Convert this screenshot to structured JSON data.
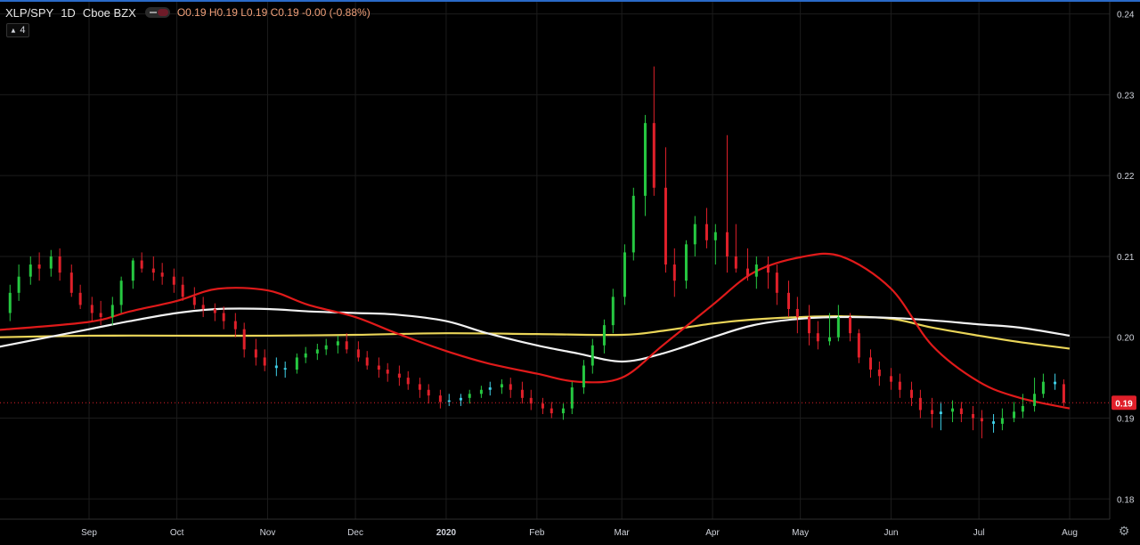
{
  "legend": {
    "symbol": "XLP/SPY",
    "timeframe": "1D",
    "exchange": "Cboe BZX",
    "open_label": "O",
    "open": "0.19",
    "high_label": "H",
    "high": "0.19",
    "low_label": "L",
    "low": "0.19",
    "close_label": "C",
    "close": "0.19",
    "change": "-0.00 (-0.88%)",
    "indicator_count": "4"
  },
  "icons": {
    "toggle": "visibility-toggle-icon",
    "collapse": "chevron-up-icon",
    "settings": "gear-icon"
  },
  "colors": {
    "background": "#000000",
    "grid": "#1c1c1c",
    "up_candle": "#26c841",
    "down_candle": "#e0202a",
    "doji_candle": "#3fd0e8",
    "ma_red": "#e01a1a",
    "ma_white": "#f2f2f2",
    "ma_yellow": "#ead558",
    "axis_text": "#d1d4dc",
    "price_badge": "#e0202a",
    "accent": "#2a6ac8"
  },
  "chart_data": {
    "type": "candlestick",
    "title": "XLP/SPY",
    "ylim": [
      0.1775,
      0.2415
    ],
    "y_ticks": [
      "0.24",
      "0.23",
      "0.22",
      "0.21",
      "0.20",
      "0.19",
      "0.18"
    ],
    "y_tick_values": [
      0.24,
      0.23,
      0.22,
      0.21,
      0.2,
      0.19,
      0.18
    ],
    "x_ticks": [
      "Sep",
      "Oct",
      "Nov",
      "Dec",
      "2020",
      "Feb",
      "Mar",
      "Apr",
      "May",
      "Jun",
      "Jul",
      "Aug"
    ],
    "x_tick_dates": [
      "2019-09-01",
      "2019-10-01",
      "2019-11-01",
      "2019-12-01",
      "2020-01-01",
      "2020-02-01",
      "2020-03-01",
      "2020-04-01",
      "2020-05-01",
      "2020-06-01",
      "2020-07-01",
      "2020-08-01"
    ],
    "last_price": "0.19",
    "last_price_value": 0.1919,
    "series": [
      {
        "name": "Close",
        "dates": [
          "2019-08-01",
          "2019-08-05",
          "2019-08-08",
          "2019-08-12",
          "2019-08-15",
          "2019-08-19",
          "2019-08-22",
          "2019-08-26",
          "2019-08-29",
          "2019-09-02",
          "2019-09-05",
          "2019-09-09",
          "2019-09-12",
          "2019-09-16",
          "2019-09-19",
          "2019-09-23",
          "2019-09-26",
          "2019-09-30",
          "2019-10-03",
          "2019-10-07",
          "2019-10-10",
          "2019-10-14",
          "2019-10-17",
          "2019-10-21",
          "2019-10-24",
          "2019-10-28",
          "2019-10-31",
          "2019-11-04",
          "2019-11-07",
          "2019-11-11",
          "2019-11-14",
          "2019-11-18",
          "2019-11-21",
          "2019-11-25",
          "2019-11-28",
          "2019-12-02",
          "2019-12-05",
          "2019-12-09",
          "2019-12-12",
          "2019-12-16",
          "2019-12-19",
          "2019-12-23",
          "2019-12-26",
          "2019-12-30",
          "2020-01-02",
          "2020-01-06",
          "2020-01-09",
          "2020-01-13",
          "2020-01-16",
          "2020-01-20",
          "2020-01-23",
          "2020-01-27",
          "2020-01-30",
          "2020-02-03",
          "2020-02-06",
          "2020-02-10",
          "2020-02-13",
          "2020-02-17",
          "2020-02-20",
          "2020-02-24",
          "2020-02-27",
          "2020-03-02",
          "2020-03-05",
          "2020-03-09",
          "2020-03-12",
          "2020-03-16",
          "2020-03-19",
          "2020-03-23",
          "2020-03-26",
          "2020-03-30",
          "2020-04-02",
          "2020-04-06",
          "2020-04-09",
          "2020-04-13",
          "2020-04-16",
          "2020-04-20",
          "2020-04-23",
          "2020-04-27",
          "2020-04-30",
          "2020-05-04",
          "2020-05-07",
          "2020-05-11",
          "2020-05-14",
          "2020-05-18",
          "2020-05-21",
          "2020-05-25",
          "2020-05-28",
          "2020-06-01",
          "2020-06-04",
          "2020-06-08",
          "2020-06-11",
          "2020-06-15",
          "2020-06-18",
          "2020-06-22",
          "2020-06-25",
          "2020-06-29",
          "2020-07-02",
          "2020-07-06",
          "2020-07-09",
          "2020-07-13",
          "2020-07-16",
          "2020-07-20",
          "2020-07-23",
          "2020-07-27",
          "2020-07-30"
        ],
        "open": [
          0.2022,
          0.203,
          0.2055,
          0.2075,
          0.209,
          0.2085,
          0.21,
          0.208,
          0.2055,
          0.204,
          0.203,
          0.2025,
          0.204,
          0.207,
          0.2095,
          0.2085,
          0.208,
          0.2075,
          0.2065,
          0.205,
          0.204,
          0.2035,
          0.203,
          0.202,
          0.201,
          0.1985,
          0.1975,
          0.1965,
          0.1962,
          0.196,
          0.1975,
          0.198,
          0.1985,
          0.199,
          0.1995,
          0.1985,
          0.1975,
          0.1965,
          0.196,
          0.1955,
          0.195,
          0.1942,
          0.1935,
          0.1928,
          0.192,
          0.1922,
          0.1925,
          0.193,
          0.1935,
          0.1938,
          0.1942,
          0.1935,
          0.1925,
          0.1918,
          0.1912,
          0.1906,
          0.1912,
          0.1938,
          0.1965,
          0.199,
          0.2015,
          0.205,
          0.2105,
          0.2175,
          0.2265,
          0.2185,
          0.209,
          0.207,
          0.2115,
          0.214,
          0.212,
          0.213,
          0.21,
          0.2085,
          0.2075,
          0.209,
          0.208,
          0.2055,
          0.2035,
          0.2025,
          0.2005,
          0.1995,
          0.2,
          0.2025,
          0.2005,
          0.1975,
          0.196,
          0.1952,
          0.1945,
          0.1935,
          0.1925,
          0.191,
          0.1905,
          0.1908,
          0.1912,
          0.1905,
          0.19,
          0.1896,
          0.1893,
          0.19,
          0.1908,
          0.1915,
          0.193,
          0.1945,
          0.1942
        ],
        "high": [
          0.2045,
          0.2065,
          0.209,
          0.21,
          0.2105,
          0.2108,
          0.211,
          0.209,
          0.2065,
          0.205,
          0.2045,
          0.205,
          0.2075,
          0.2098,
          0.2105,
          0.21,
          0.2092,
          0.2085,
          0.2075,
          0.2062,
          0.205,
          0.2042,
          0.2038,
          0.203,
          0.2018,
          0.1998,
          0.1985,
          0.1975,
          0.197,
          0.198,
          0.1988,
          0.1992,
          0.1998,
          0.2002,
          0.2005,
          0.1995,
          0.1983,
          0.1975,
          0.1968,
          0.1965,
          0.1958,
          0.195,
          0.1942,
          0.1935,
          0.193,
          0.193,
          0.1935,
          0.194,
          0.1945,
          0.1948,
          0.195,
          0.1945,
          0.1935,
          0.1925,
          0.192,
          0.1918,
          0.1945,
          0.1972,
          0.1998,
          0.2022,
          0.206,
          0.2115,
          0.2185,
          0.2275,
          0.2335,
          0.2235,
          0.211,
          0.212,
          0.215,
          0.216,
          0.214,
          0.225,
          0.214,
          0.211,
          0.21,
          0.21,
          0.209,
          0.207,
          0.205,
          0.204,
          0.202,
          0.203,
          0.204,
          0.203,
          0.201,
          0.1985,
          0.197,
          0.1962,
          0.1955,
          0.1945,
          0.1935,
          0.1925,
          0.192,
          0.1922,
          0.192,
          0.1915,
          0.191,
          0.1905,
          0.1912,
          0.192,
          0.193,
          0.195,
          0.1955,
          0.1955,
          0.1948
        ],
        "low": [
          0.201,
          0.202,
          0.2045,
          0.2065,
          0.207,
          0.2075,
          0.207,
          0.205,
          0.2035,
          0.202,
          0.2015,
          0.2015,
          0.203,
          0.206,
          0.208,
          0.207,
          0.2065,
          0.2055,
          0.2045,
          0.2035,
          0.2025,
          0.202,
          0.201,
          0.2,
          0.1975,
          0.1965,
          0.1958,
          0.1952,
          0.195,
          0.1955,
          0.1968,
          0.1972,
          0.1978,
          0.198,
          0.198,
          0.197,
          0.196,
          0.195,
          0.1945,
          0.194,
          0.1935,
          0.1925,
          0.1918,
          0.1912,
          0.1915,
          0.1915,
          0.1918,
          0.1925,
          0.1928,
          0.193,
          0.1925,
          0.1918,
          0.191,
          0.1905,
          0.19,
          0.1898,
          0.1905,
          0.193,
          0.1955,
          0.198,
          0.2005,
          0.204,
          0.2095,
          0.215,
          0.2175,
          0.208,
          0.205,
          0.206,
          0.21,
          0.211,
          0.209,
          0.208,
          0.208,
          0.207,
          0.206,
          0.206,
          0.204,
          0.2025,
          0.2005,
          0.199,
          0.1985,
          0.199,
          0.1995,
          0.1995,
          0.1968,
          0.195,
          0.194,
          0.1935,
          0.1925,
          0.1915,
          0.19,
          0.1888,
          0.1885,
          0.1895,
          0.1895,
          0.1885,
          0.1875,
          0.1882,
          0.1885,
          0.1895,
          0.19,
          0.1908,
          0.1925,
          0.1935,
          0.1915
        ],
        "close": [
          0.203,
          0.2055,
          0.2075,
          0.209,
          0.2085,
          0.21,
          0.208,
          0.2055,
          0.204,
          0.203,
          0.2025,
          0.204,
          0.207,
          0.2095,
          0.2085,
          0.208,
          0.2075,
          0.2065,
          0.205,
          0.204,
          0.2035,
          0.203,
          0.202,
          0.201,
          0.1985,
          0.1975,
          0.1965,
          0.1962,
          0.196,
          0.1975,
          0.198,
          0.1985,
          0.199,
          0.1995,
          0.1985,
          0.1975,
          0.1965,
          0.196,
          0.1955,
          0.195,
          0.1942,
          0.1935,
          0.1928,
          0.192,
          0.1922,
          0.1925,
          0.193,
          0.1935,
          0.1938,
          0.1942,
          0.1935,
          0.1925,
          0.1918,
          0.1912,
          0.1906,
          0.1912,
          0.1938,
          0.1965,
          0.199,
          0.2015,
          0.205,
          0.2105,
          0.2175,
          0.2265,
          0.2185,
          0.209,
          0.207,
          0.2115,
          0.214,
          0.212,
          0.213,
          0.21,
          0.2085,
          0.2075,
          0.209,
          0.208,
          0.2055,
          0.2035,
          0.2025,
          0.2005,
          0.1995,
          0.2,
          0.2025,
          0.2005,
          0.1975,
          0.196,
          0.1952,
          0.1945,
          0.1935,
          0.1925,
          0.191,
          0.1905,
          0.1908,
          0.1912,
          0.1905,
          0.19,
          0.1896,
          0.1893,
          0.19,
          0.1908,
          0.1915,
          0.193,
          0.1945,
          0.1942,
          0.1919
        ]
      },
      {
        "name": "",
        "color": "#e01a1a",
        "dates": [
          "2019-08-01",
          "2019-09-01",
          "2019-09-15",
          "2019-10-01",
          "2019-10-15",
          "2019-11-01",
          "2019-11-15",
          "2019-12-01",
          "2019-12-15",
          "2020-01-01",
          "2020-01-15",
          "2020-02-01",
          "2020-02-15",
          "2020-03-01",
          "2020-03-15",
          "2020-04-01",
          "2020-04-15",
          "2020-05-01",
          "2020-05-15",
          "2020-06-01",
          "2020-06-15",
          "2020-07-01",
          "2020-07-15",
          "2020-08-01"
        ],
        "values": [
          0.2009,
          0.2019,
          0.2032,
          0.2045,
          0.206,
          0.2058,
          0.204,
          0.2025,
          0.2005,
          0.1983,
          0.1968,
          0.1955,
          0.1945,
          0.195,
          0.199,
          0.204,
          0.208,
          0.2099,
          0.21,
          0.206,
          0.199,
          0.1945,
          0.1925,
          0.1912
        ]
      },
      {
        "name": "",
        "color": "#f2f2f2",
        "dates": [
          "2019-08-01",
          "2019-09-01",
          "2019-09-15",
          "2019-10-01",
          "2019-10-15",
          "2019-11-01",
          "2019-11-15",
          "2019-12-01",
          "2019-12-15",
          "2020-01-01",
          "2020-01-15",
          "2020-02-01",
          "2020-02-15",
          "2020-03-01",
          "2020-03-15",
          "2020-04-01",
          "2020-04-15",
          "2020-05-01",
          "2020-05-15",
          "2020-06-01",
          "2020-06-15",
          "2020-07-01",
          "2020-07-15",
          "2020-08-01"
        ],
        "values": [
          0.1988,
          0.201,
          0.202,
          0.203,
          0.2035,
          0.2035,
          0.2032,
          0.203,
          0.2028,
          0.202,
          0.2005,
          0.199,
          0.198,
          0.197,
          0.198,
          0.2,
          0.2015,
          0.2023,
          0.2025,
          0.2024,
          0.2021,
          0.2016,
          0.2012,
          0.2002
        ]
      },
      {
        "name": "",
        "color": "#ead558",
        "dates": [
          "2019-08-01",
          "2019-09-01",
          "2019-10-01",
          "2019-11-01",
          "2019-12-01",
          "2020-01-01",
          "2020-02-01",
          "2020-03-01",
          "2020-03-15",
          "2020-04-01",
          "2020-04-15",
          "2020-05-01",
          "2020-05-15",
          "2020-06-01",
          "2020-06-15",
          "2020-07-01",
          "2020-07-15",
          "2020-08-01"
        ],
        "values": [
          0.2,
          0.2002,
          0.2002,
          0.2002,
          0.2003,
          0.2005,
          0.2004,
          0.2003,
          0.2008,
          0.2017,
          0.2022,
          0.2025,
          0.2026,
          0.2023,
          0.2012,
          0.2002,
          0.1994,
          0.1986
        ]
      }
    ]
  }
}
